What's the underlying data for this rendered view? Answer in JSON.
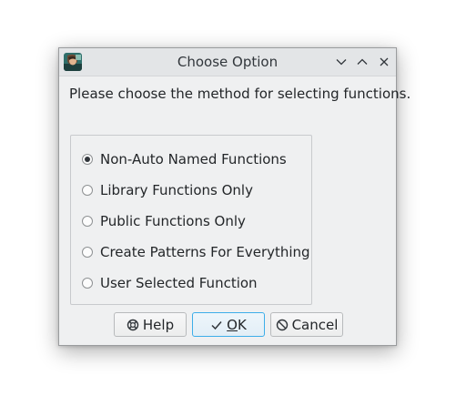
{
  "window": {
    "title": "Choose Option"
  },
  "prompt": "Please choose the method for selecting functions.",
  "options": [
    {
      "label": "Non-Auto Named Functions",
      "selected": true
    },
    {
      "label": "Library Functions Only",
      "selected": false
    },
    {
      "label": "Public Functions Only",
      "selected": false
    },
    {
      "label": "Create Patterns For Everything",
      "selected": false
    },
    {
      "label": "User Selected Function",
      "selected": false
    }
  ],
  "buttons": {
    "help": "Help",
    "ok_prefix": "O",
    "ok_suffix": "K",
    "cancel": "Cancel"
  },
  "icons": {
    "help": "help-lifebuoy-icon",
    "ok": "checkmark-icon",
    "cancel": "cancel-circle-slash-icon",
    "minimize": "chevron-down-icon",
    "maximize": "chevron-up-icon",
    "close": "close-icon",
    "app": "app-icon"
  },
  "colors": {
    "default_button_border": "#3daee9",
    "dialog_background": "#eff0f1"
  }
}
